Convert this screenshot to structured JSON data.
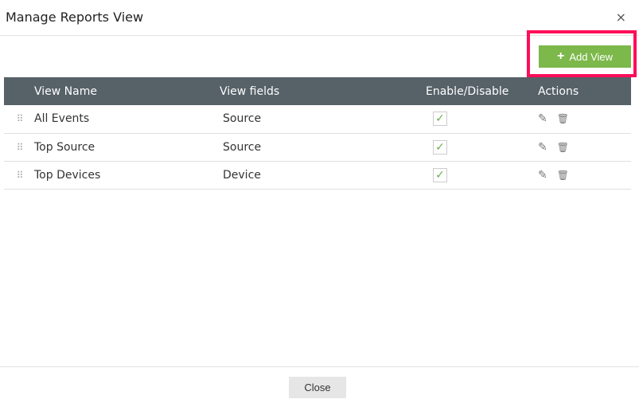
{
  "dialog": {
    "title": "Manage Reports View",
    "close_icon": "×"
  },
  "toolbar": {
    "add_label": "Add View",
    "add_icon": "+"
  },
  "table": {
    "headers": [
      "View Name",
      "View fields",
      "Enable/Disable",
      "Actions"
    ],
    "rows": [
      {
        "name": "All Events",
        "field": "Source",
        "enabled": true
      },
      {
        "name": "Top Source",
        "field": "Source",
        "enabled": true
      },
      {
        "name": "Top Devices",
        "field": "Device",
        "enabled": true
      }
    ]
  },
  "icons": {
    "drag": "⠿",
    "check": "✓",
    "edit": "✎",
    "delete": "🗑"
  },
  "footer": {
    "close_label": "Close"
  },
  "colors": {
    "accent": "#7cb84a",
    "header": "#566168",
    "highlight": "#ff0d5a"
  }
}
